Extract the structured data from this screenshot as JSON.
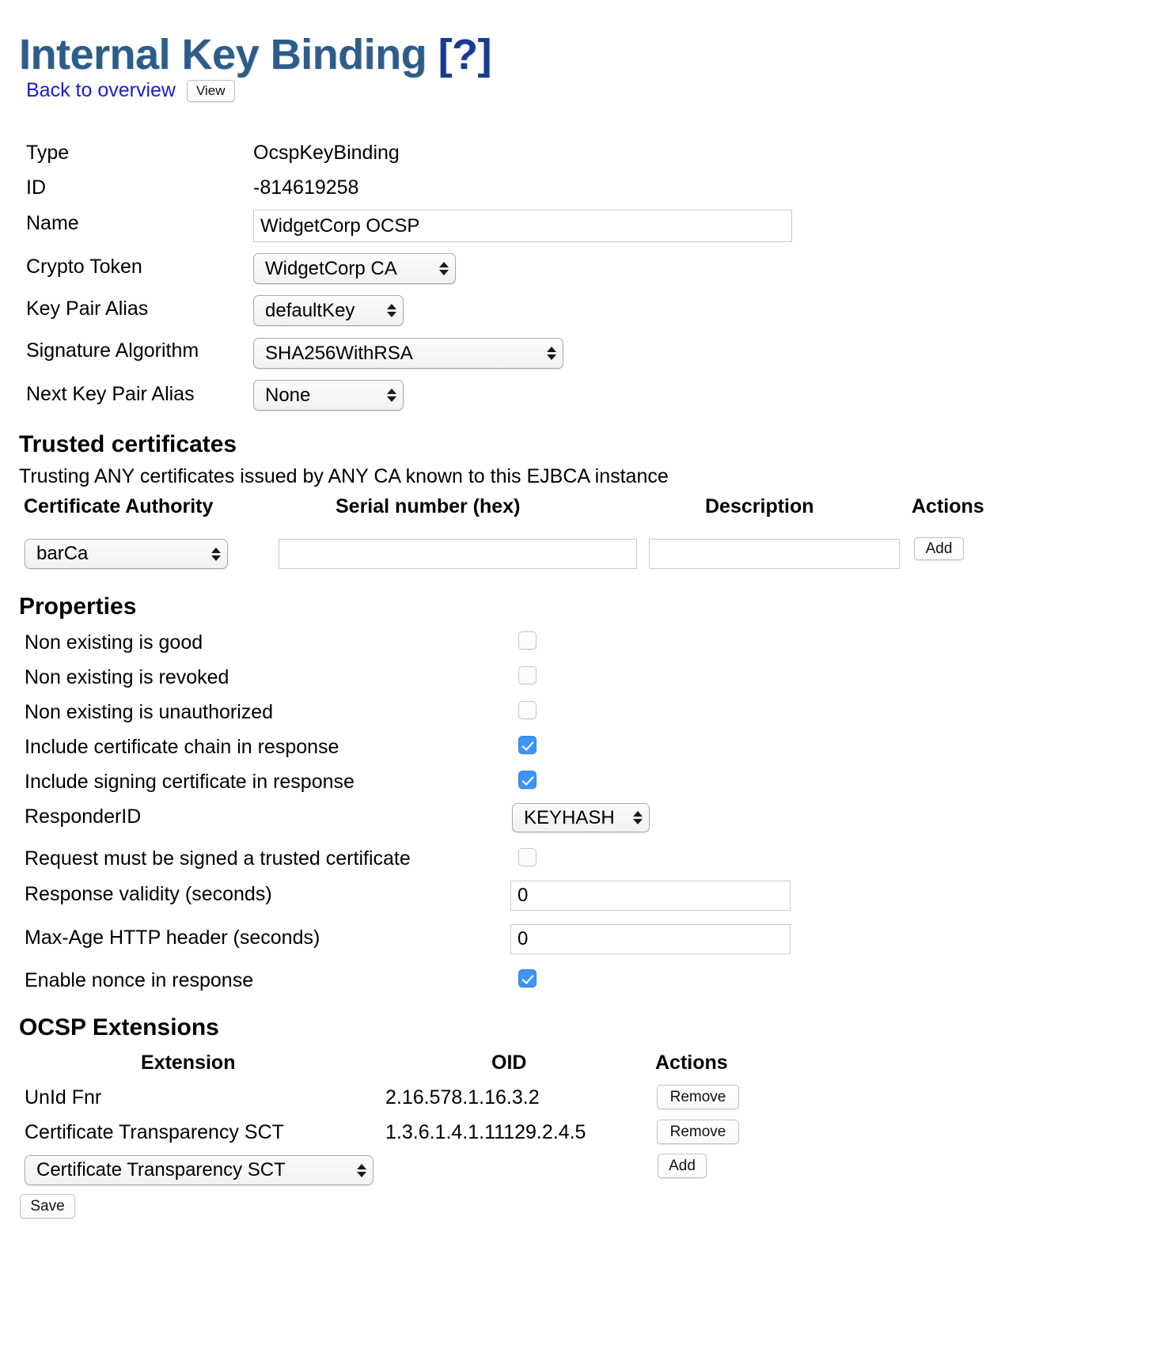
{
  "header": {
    "title_main": "Internal Key Binding ",
    "title_help": "[?]",
    "back_link": "Back to overview",
    "view_button": "View"
  },
  "binding": {
    "type_label": "Type",
    "type_value": "OcspKeyBinding",
    "id_label": "ID",
    "id_value": "-814619258",
    "name_label": "Name",
    "name_value": "WidgetCorp OCSP",
    "crypto_token_label": "Crypto Token",
    "crypto_token_value": "WidgetCorp CA",
    "key_pair_alias_label": "Key Pair Alias",
    "key_pair_alias_value": "defaultKey",
    "signature_algorithm_label": "Signature Algorithm",
    "signature_algorithm_value": "SHA256WithRSA",
    "next_key_pair_alias_label": "Next Key Pair Alias",
    "next_key_pair_alias_value": "None"
  },
  "trusted_certificates": {
    "heading": "Trusted certificates",
    "subtitle": "Trusting ANY certificates issued by ANY CA known to this EJBCA instance",
    "columns": {
      "ca": "Certificate Authority",
      "serial": "Serial number (hex)",
      "description": "Description",
      "actions": "Actions"
    },
    "row": {
      "ca_value": "barCa",
      "serial_value": "",
      "serial_placeholder": "",
      "description_value": "",
      "description_placeholder": "",
      "add_button": "Add"
    }
  },
  "properties": {
    "heading": "Properties",
    "items": [
      {
        "label": "Non existing is good",
        "checked": false
      },
      {
        "label": "Non existing is revoked",
        "checked": false
      },
      {
        "label": "Non existing is unauthorized",
        "checked": false
      },
      {
        "label": "Include certificate chain in response",
        "checked": true
      },
      {
        "label": "Include signing certificate in response",
        "checked": true
      }
    ],
    "responder_id_label": "ResponderID",
    "responder_id_value": "KEYHASH",
    "request_signed_label": "Request must be signed a trusted certificate",
    "request_signed_checked": false,
    "response_validity_label": "Response validity (seconds)",
    "response_validity_value": "0",
    "max_age_label": "Max-Age HTTP header (seconds)",
    "max_age_value": "0",
    "nonce_label": "Enable nonce in response",
    "nonce_checked": true
  },
  "ocsp_extensions": {
    "heading": "OCSP Extensions",
    "columns": {
      "extension": "Extension",
      "oid": "OID",
      "actions": "Actions"
    },
    "rows": [
      {
        "extension": "UnId Fnr",
        "oid": "2.16.578.1.16.3.2",
        "action": "Remove"
      },
      {
        "extension": "Certificate Transparency SCT",
        "oid": "1.3.6.1.4.1.11129.2.4.5",
        "action": "Remove"
      }
    ],
    "add_select_value": "Certificate Transparency SCT",
    "add_button": "Add"
  },
  "footer": {
    "save_button": "Save"
  },
  "colors": {
    "title": "#2e5c8a",
    "title_help": "#1a3a8f",
    "link": "#1b1bd6",
    "checkbox_on": "#3d94f6"
  }
}
